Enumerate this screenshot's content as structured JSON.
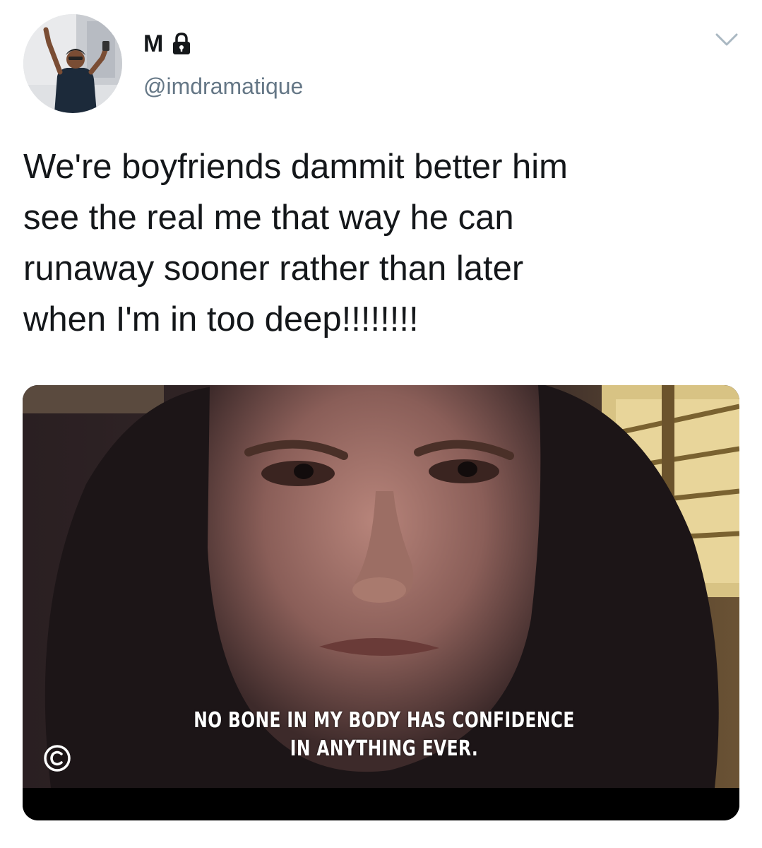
{
  "tweet": {
    "display_name": "M",
    "handle": "@imdramatique",
    "text": "We're boyfriends dammit better him\nsee the real me that way he can\nrunaway sooner rather than later\nwhen I'm in too deep!!!!!!!!",
    "media": {
      "subtitle_line_1": "NO BONE IN MY BODY HAS CONFIDENCE",
      "subtitle_line_2": "IN ANYTHING EVER."
    }
  },
  "icons": {
    "lock": "lock-icon",
    "more": "chevron-down-icon",
    "channel_logo": "comedy-central-logo-icon"
  },
  "colors": {
    "text_primary": "#14171a",
    "text_secondary": "#657786",
    "background": "#ffffff"
  }
}
